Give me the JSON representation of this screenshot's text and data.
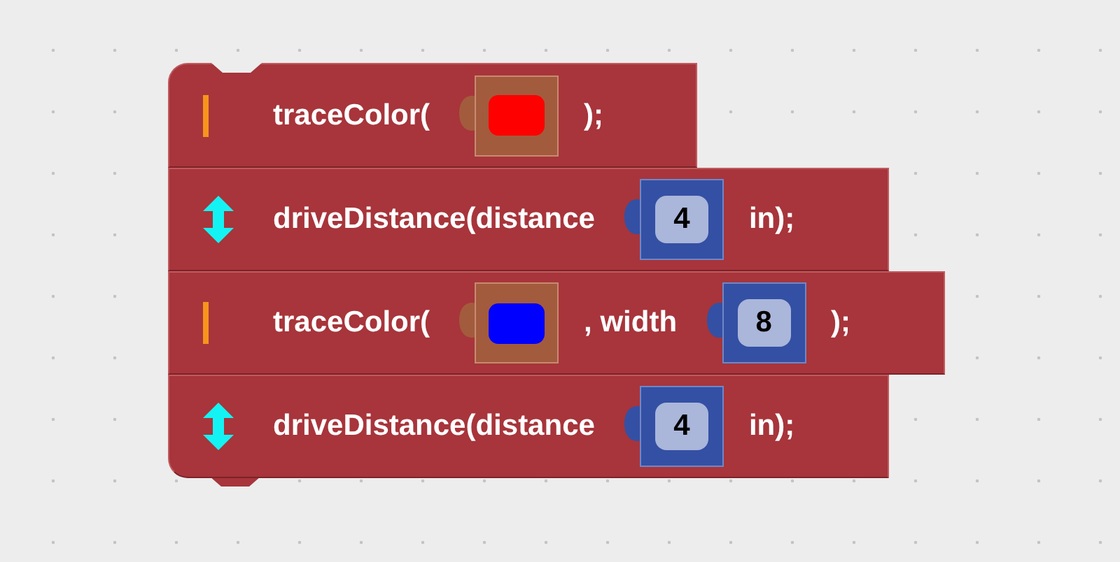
{
  "blocks": [
    {
      "kind": "pen",
      "parts": [
        {
          "kind": "text",
          "text": "traceColor("
        },
        {
          "kind": "color",
          "color": "#ff0000"
        },
        {
          "kind": "text",
          "text": ");"
        }
      ]
    },
    {
      "kind": "drive",
      "parts": [
        {
          "kind": "text",
          "text": "driveDistance(distance"
        },
        {
          "kind": "number",
          "text": "4"
        },
        {
          "kind": "text",
          "text": "in);"
        }
      ]
    },
    {
      "kind": "pen",
      "parts": [
        {
          "kind": "text",
          "text": "traceColor("
        },
        {
          "kind": "color",
          "color": "#0000ff"
        },
        {
          "kind": "text",
          "text": ", width"
        },
        {
          "kind": "number",
          "text": "8"
        },
        {
          "kind": "text",
          "text": ");"
        }
      ]
    },
    {
      "kind": "drive",
      "parts": [
        {
          "kind": "text",
          "text": "driveDistance(distance"
        },
        {
          "kind": "number",
          "text": "4"
        },
        {
          "kind": "text",
          "text": "in);"
        }
      ]
    }
  ]
}
